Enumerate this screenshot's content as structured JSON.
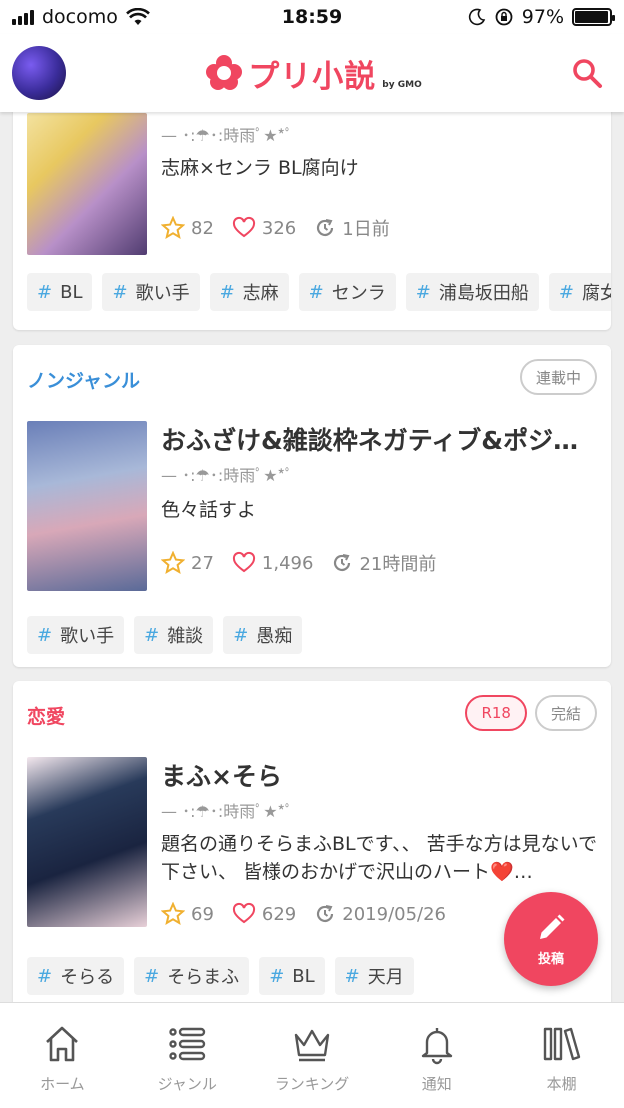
{
  "status_bar": {
    "carrier": "docomo",
    "time": "18:59",
    "battery": "97%",
    "battery_level": 0.97
  },
  "header": {
    "logo_text": "プリ小説",
    "logo_by": "by GMO"
  },
  "cards": [
    {
      "genre": "",
      "badges": [],
      "title": "",
      "author": "— ･:☂･:時雨ﾟ★*ﾟ",
      "description": "志麻×センラ BL腐向け",
      "stars": "82",
      "likes": "326",
      "updated": "1日前",
      "tags": [
        "BL",
        "歌い手",
        "志麻",
        "センラ",
        "浦島坂田船",
        "腐女子"
      ]
    },
    {
      "genre": "ノンジャンル",
      "genre_color": "#3a8fd8",
      "badges": [
        "連載中"
      ],
      "title": "おふざけ&雑談枠ネガティブ&ポジティブ",
      "author": "— ･:☂･:時雨ﾟ★*ﾟ",
      "description": "色々話すよ",
      "stars": "27",
      "likes": "1,496",
      "updated": "21時間前",
      "tags": [
        "歌い手",
        "雑談",
        "愚痴"
      ]
    },
    {
      "genre": "恋愛",
      "genre_color": "#f04660",
      "badges": [
        "R18",
        "完結"
      ],
      "title": "まふ×そら",
      "author": "— ･:☂･:時雨ﾟ★*ﾟ",
      "description": "題名の通りそらまふBLです、、 苦手な方は見ないで下さい、 皆様のおかげで沢山のハート❤️…",
      "stars": "69",
      "likes": "629",
      "updated": "2019/05/26",
      "tags": [
        "そらる",
        "そらまふ",
        "BL",
        "天月"
      ]
    }
  ],
  "fab": {
    "label": "投稿",
    "icon": "pencil-icon"
  },
  "tabbar": [
    {
      "label": "ホーム",
      "icon": "home-icon"
    },
    {
      "label": "ジャンル",
      "icon": "list-icon"
    },
    {
      "label": "ランキング",
      "icon": "crown-icon"
    },
    {
      "label": "通知",
      "icon": "bell-icon"
    },
    {
      "label": "本棚",
      "icon": "bookshelf-icon"
    }
  ],
  "colors": {
    "accent": "#f04660",
    "tag_hash": "#4aa8e0",
    "star": "#f0b030"
  }
}
